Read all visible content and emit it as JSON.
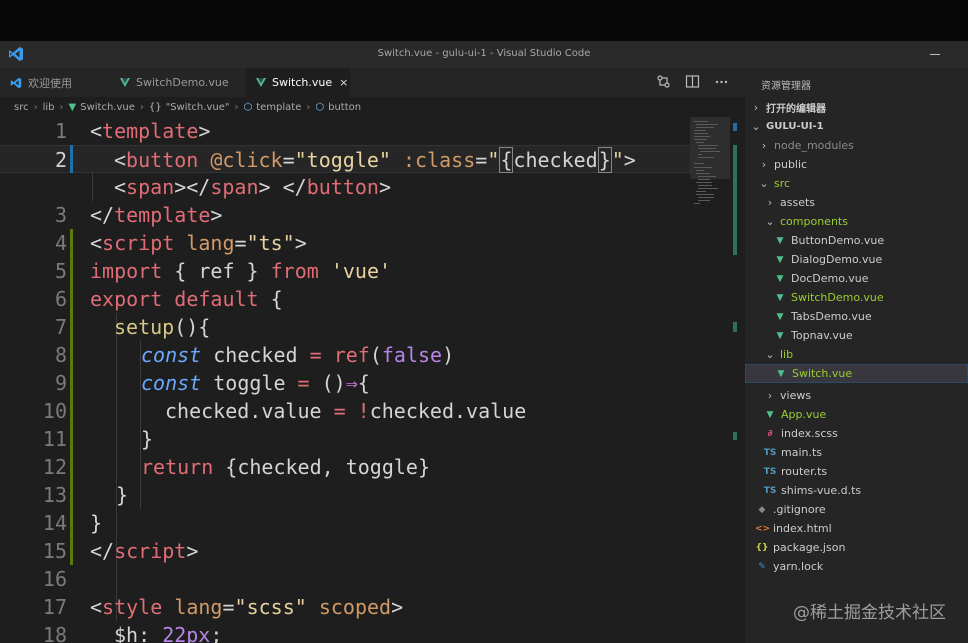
{
  "window": {
    "title": "Switch.vue - gulu-ui-1 - Visual Studio Code"
  },
  "tabs": [
    {
      "label": "欢迎使用",
      "icon": "vscode-icon",
      "active": false
    },
    {
      "label": "SwitchDemo.vue",
      "icon": "vue-icon",
      "active": false
    },
    {
      "label": "Switch.vue",
      "icon": "vue-icon",
      "active": true,
      "close": "×"
    }
  ],
  "tab_actions": [
    "compare-icon",
    "split-editor-icon",
    "more-actions-icon"
  ],
  "breadcrumb": {
    "parts": [
      "src",
      "lib",
      "Switch.vue",
      "\"Switch.vue\"",
      "template",
      "button"
    ],
    "brace": "{}"
  },
  "editor": {
    "lines": [
      {
        "n": "1"
      },
      {
        "n": "2"
      },
      {
        "n": "3"
      },
      {
        "n": "4"
      },
      {
        "n": "5"
      },
      {
        "n": "6"
      },
      {
        "n": "7"
      },
      {
        "n": "8"
      },
      {
        "n": "9"
      },
      {
        "n": "10"
      },
      {
        "n": "11"
      },
      {
        "n": "12"
      },
      {
        "n": "13"
      },
      {
        "n": "14"
      },
      {
        "n": "15"
      },
      {
        "n": "16"
      },
      {
        "n": "17"
      },
      {
        "n": "18"
      }
    ],
    "tokens": {
      "l1": [
        "<",
        "template",
        ">"
      ],
      "l2": [
        "<",
        "button",
        " ",
        "@click",
        "=",
        "\"toggle\"",
        " ",
        ":class",
        "=",
        "\"",
        "{",
        "checked",
        "}",
        "\"",
        ">"
      ],
      "l3": [
        "<",
        "span",
        "></",
        "span",
        "> </",
        "button",
        ">"
      ],
      "l4": [
        "</",
        "template",
        ">"
      ],
      "l5": [
        "<",
        "script",
        " ",
        "lang",
        "=",
        "\"ts\"",
        ">"
      ],
      "l6": [
        "import",
        " { ref } ",
        "from",
        " ",
        "'vue'"
      ],
      "l7": [
        "export",
        " ",
        "default",
        " {"
      ],
      "l8": [
        "setup",
        "(){"
      ],
      "l9": [
        "const",
        " checked ",
        "=",
        " ",
        "ref",
        "(",
        "false",
        ")"
      ],
      "l10": [
        "const",
        " toggle ",
        "=",
        " ()",
        "⇒",
        "{"
      ],
      "l11": [
        "checked.value ",
        "=",
        " ",
        "!",
        "checked.value"
      ],
      "l12": [
        "}"
      ],
      "l13": [
        "return",
        " {checked, toggle}"
      ],
      "l14": [
        "}"
      ],
      "l15": [
        "}"
      ],
      "l16": [
        "</",
        "script",
        ">"
      ],
      "l17": [
        "<",
        "style",
        " ",
        "lang",
        "=",
        "\"scss\"",
        " ",
        "scoped",
        ">"
      ],
      "l18": [
        "$h",
        ":",
        " ",
        "22px",
        ";"
      ]
    }
  },
  "sidebar": {
    "header": "资源管理器",
    "rows": [
      {
        "label": "打开的编辑器",
        "chev": "›",
        "icon": "",
        "bold": true
      },
      {
        "label": "GULU-UI-1",
        "chev": "⌄",
        "icon": "",
        "bold": true
      },
      {
        "label": "node_modules",
        "chev": "›",
        "icon": ""
      },
      {
        "label": "public",
        "chev": "›",
        "icon": ""
      },
      {
        "label": "src",
        "chev": "⌄",
        "icon": ""
      },
      {
        "label": "assets",
        "chev": "›",
        "icon": ""
      },
      {
        "label": "components",
        "chev": "⌄",
        "icon": ""
      },
      {
        "label": "ButtonDemo.vue",
        "chev": "",
        "icon": "▼"
      },
      {
        "label": "DialogDemo.vue",
        "chev": "",
        "icon": "▼"
      },
      {
        "label": "DocDemo.vue",
        "chev": "",
        "icon": "▼"
      },
      {
        "label": "SwitchDemo.vue",
        "chev": "",
        "icon": "▼"
      },
      {
        "label": "TabsDemo.vue",
        "chev": "",
        "icon": "▼"
      },
      {
        "label": "Topnav.vue",
        "chev": "",
        "icon": "▼"
      },
      {
        "label": "lib",
        "chev": "⌄",
        "icon": ""
      },
      {
        "label": "Switch.vue",
        "chev": "",
        "icon": "▼"
      },
      {
        "label": "views",
        "chev": "›",
        "icon": ""
      },
      {
        "label": "App.vue",
        "chev": "",
        "icon": "▼"
      },
      {
        "label": "index.scss",
        "chev": "",
        "icon": "∂"
      },
      {
        "label": "main.ts",
        "chev": "",
        "icon": "TS"
      },
      {
        "label": "router.ts",
        "chev": "",
        "icon": "TS"
      },
      {
        "label": "shims-vue.d.ts",
        "chev": "",
        "icon": "TS"
      },
      {
        "label": ".gitignore",
        "chev": "",
        "icon": "◆"
      },
      {
        "label": "index.html",
        "chev": "",
        "icon": "<>"
      },
      {
        "label": "package.json",
        "chev": "",
        "icon": "{}"
      },
      {
        "label": "yarn.lock",
        "chev": "",
        "icon": "✎"
      }
    ]
  },
  "watermark": "@稀土掘金技术社区",
  "colors": {
    "accent": "#0e639c",
    "vue": "#4fc08d",
    "ts": "#519aba",
    "tag": "#e06c75",
    "keyword": "#c678dd",
    "string": "#e8d3a0"
  }
}
